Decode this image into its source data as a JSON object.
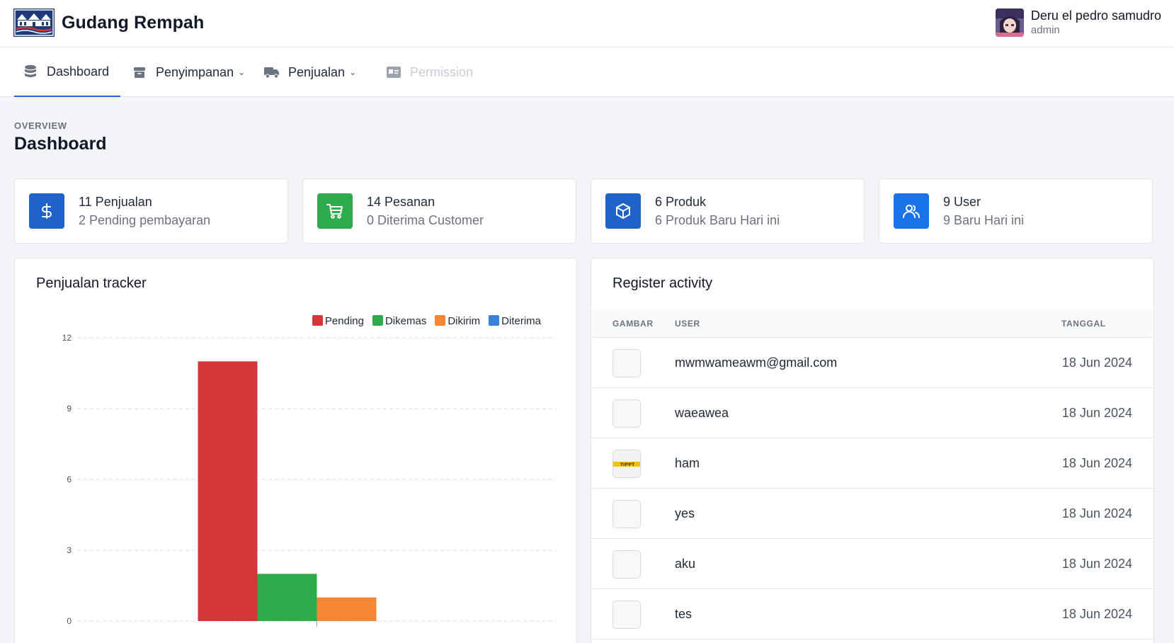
{
  "brand": {
    "name": "Gudang Rempah",
    "logo_icon": "warehouse-logo"
  },
  "user": {
    "name": "Deru el pedro samudro",
    "role": "admin"
  },
  "nav": [
    {
      "label": "Dashboard",
      "icon": "database-icon",
      "active": true
    },
    {
      "label": "Penyimpanan",
      "icon": "archive-box-icon",
      "dropdown": true
    },
    {
      "label": "Penjualan",
      "icon": "truck-icon",
      "dropdown": true
    },
    {
      "label": "Permission",
      "icon": "id-card-icon",
      "disabled": true
    }
  ],
  "page": {
    "overline": "OVERVIEW",
    "title": "Dashboard"
  },
  "stats": [
    {
      "line1": "11 Penjualan",
      "line2": "2 Pending pembayaran",
      "icon": "dollar-icon",
      "color": "#1f63c9"
    },
    {
      "line1": "14 Pesanan",
      "line2": "0 Diterima Customer",
      "icon": "cart-icon",
      "color": "#2eab4a"
    },
    {
      "line1": "6 Produk",
      "line2": "6 Produk Baru Hari ini",
      "icon": "box-icon",
      "color": "#1f63c9"
    },
    {
      "line1": "9 User",
      "line2": "9 Baru Hari ini",
      "icon": "users-icon",
      "color": "#1a73e8"
    }
  ],
  "tracker": {
    "title": "Penjualan tracker",
    "legend": [
      "Pending",
      "Dikemas",
      "Dikirim",
      "Diterima"
    ]
  },
  "chart_data": {
    "type": "bar",
    "title": "Penjualan tracker",
    "categories": [
      ""
    ],
    "series": [
      {
        "name": "Pending",
        "values": [
          11
        ],
        "color": "#d63638"
      },
      {
        "name": "Dikemas",
        "values": [
          2
        ],
        "color": "#2eab4a"
      },
      {
        "name": "Dikirim",
        "values": [
          1
        ],
        "color": "#f58634"
      },
      {
        "name": "Diterima",
        "values": [
          0
        ],
        "color": "#3b82d6"
      }
    ],
    "ylim": [
      0,
      12
    ],
    "yticks": [
      "0",
      "3",
      "6",
      "9",
      "12"
    ],
    "grid": true,
    "legend": "top-right"
  },
  "activity": {
    "title": "Register activity",
    "columns": [
      "GAMBAR",
      "USER",
      "TANGGAL"
    ],
    "rows": [
      {
        "user": "mwmwameawm@gmail.com",
        "date": "18 Jun 2024"
      },
      {
        "user": "waeawea",
        "date": "18 Jun 2024"
      },
      {
        "user": "ham",
        "date": "18 Jun 2024",
        "thumb_text": "TIPPT"
      },
      {
        "user": "yes",
        "date": "18 Jun 2024"
      },
      {
        "user": "aku",
        "date": "18 Jun 2024"
      },
      {
        "user": "tes",
        "date": "18 Jun 2024"
      }
    ]
  }
}
